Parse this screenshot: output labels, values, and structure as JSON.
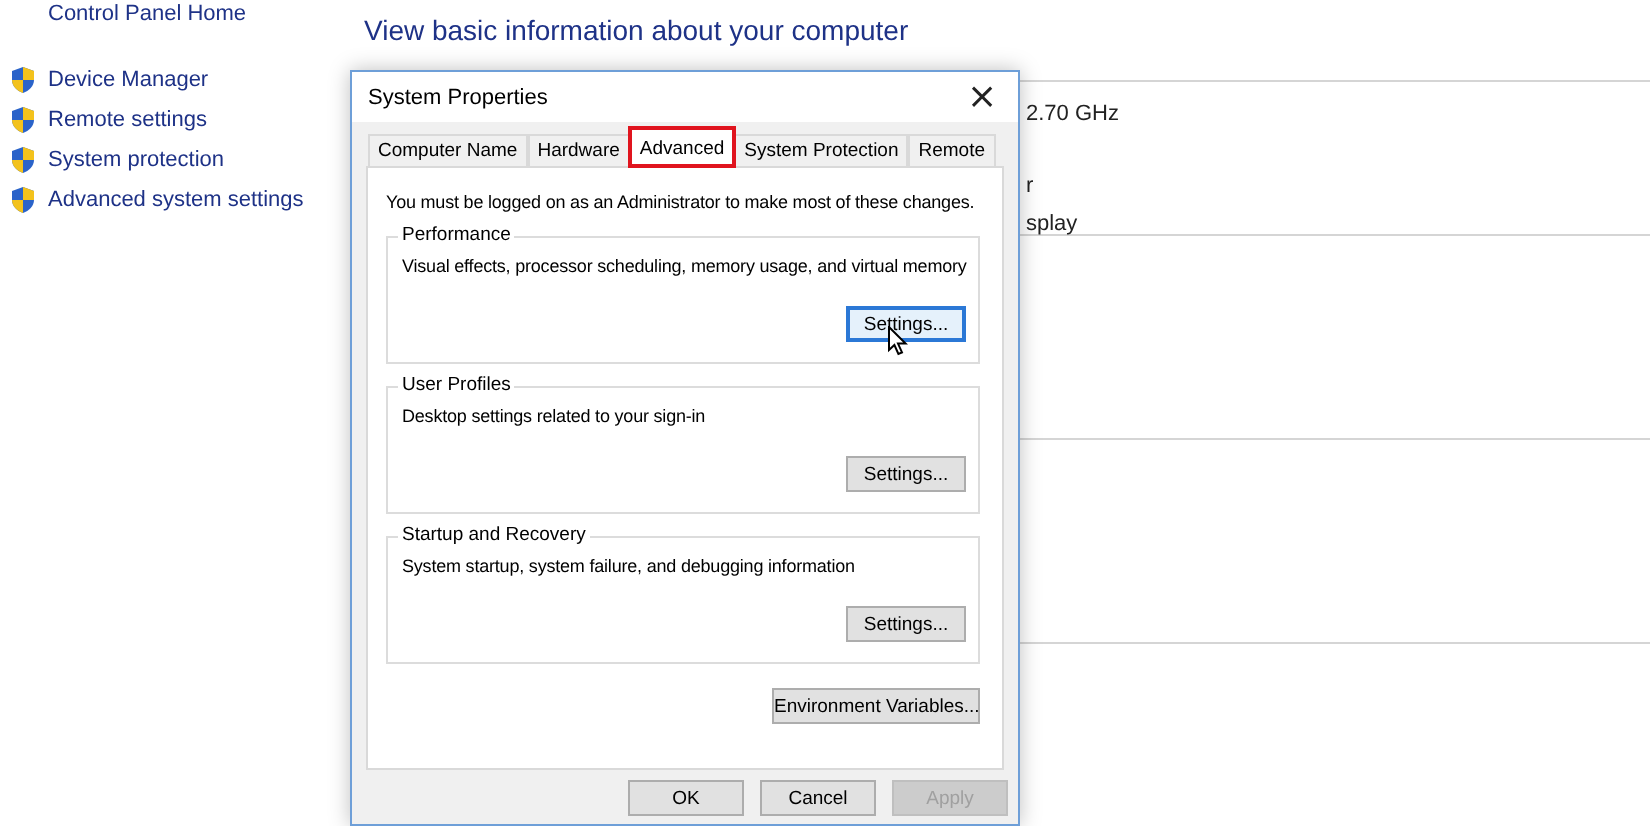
{
  "sidebar": {
    "home_link": "Control Panel Home",
    "items": [
      {
        "label": "Device Manager"
      },
      {
        "label": "Remote settings"
      },
      {
        "label": "System protection"
      },
      {
        "label": "Advanced system settings"
      }
    ]
  },
  "main": {
    "heading": "View basic information about your computer",
    "info_lines": [
      "2.70 GHz",
      "r",
      "splay"
    ]
  },
  "dialog": {
    "title": "System Properties",
    "close": "×",
    "tabs": [
      {
        "label": "Computer Name",
        "selected": false,
        "highlighted": false
      },
      {
        "label": "Hardware",
        "selected": false,
        "highlighted": false
      },
      {
        "label": "Advanced",
        "selected": true,
        "highlighted": true
      },
      {
        "label": "System Protection",
        "selected": false,
        "highlighted": false
      },
      {
        "label": "Remote",
        "selected": false,
        "highlighted": false
      }
    ],
    "notice": "You must be logged on as an Administrator to make most of these changes.",
    "groups": [
      {
        "title": "Performance",
        "description": "Visual effects, processor scheduling, memory usage, and virtual memory",
        "button": "Settings...",
        "focused": true,
        "pointer": true
      },
      {
        "title": "User Profiles",
        "description": "Desktop settings related to your sign-in",
        "button": "Settings...",
        "focused": false,
        "pointer": false
      },
      {
        "title": "Startup and Recovery",
        "description": "System startup, system failure, and debugging information",
        "button": "Settings...",
        "focused": false,
        "pointer": false
      }
    ],
    "extra_button": "Environment Variables...",
    "buttons": [
      {
        "label": "OK",
        "disabled": false
      },
      {
        "label": "Cancel",
        "disabled": false
      },
      {
        "label": "Apply",
        "disabled": true
      }
    ]
  }
}
